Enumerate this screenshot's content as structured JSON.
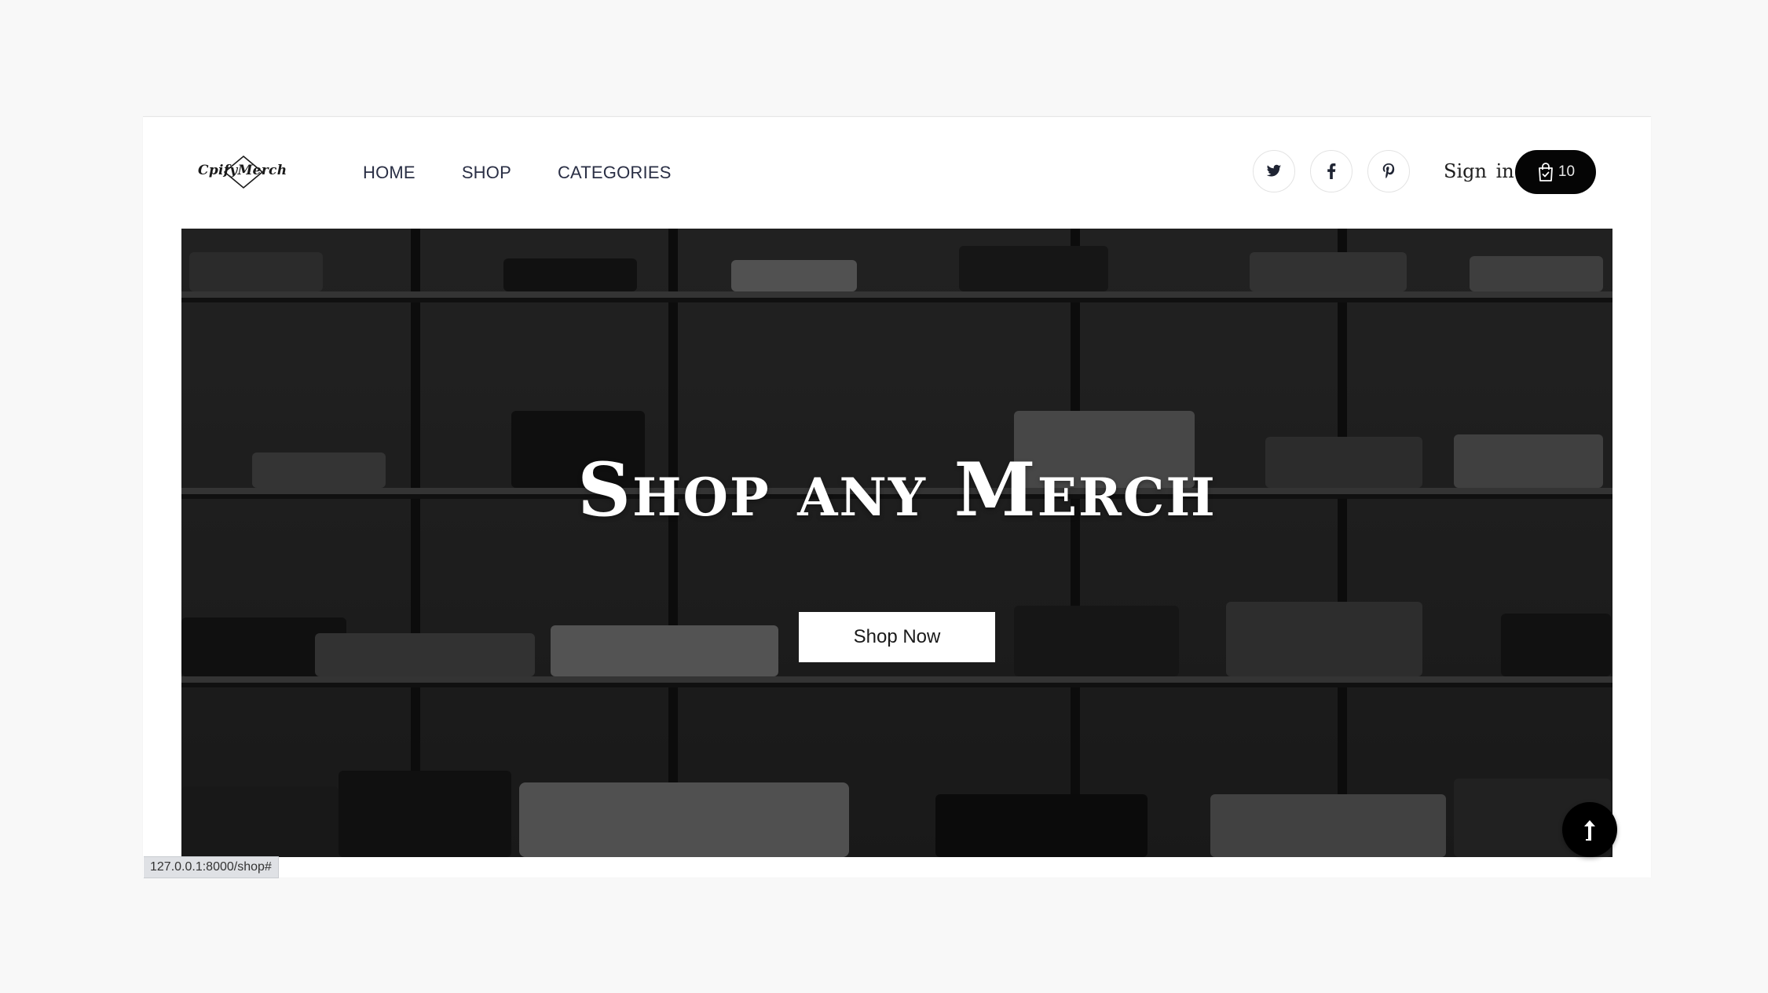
{
  "logo": {
    "text": "CpifyMerch"
  },
  "nav": [
    {
      "label": "HOME"
    },
    {
      "label": "SHOP"
    },
    {
      "label": "CATEGORIES"
    }
  ],
  "header": {
    "social_icons": [
      "twitter-icon",
      "facebook-icon",
      "pinterest-icon"
    ],
    "sign_in_label": "Sign in",
    "cart_count": "10"
  },
  "hero": {
    "title": "Shop any Merch",
    "button_label": "Shop Now"
  },
  "status_bar": {
    "url": "127.0.0.1:8000/shop#"
  },
  "colors": {
    "nav_text": "#2a2f45",
    "cart_bg": "#050505",
    "hero_overlay": "#000000",
    "page_bg": "#f8f8f8"
  }
}
